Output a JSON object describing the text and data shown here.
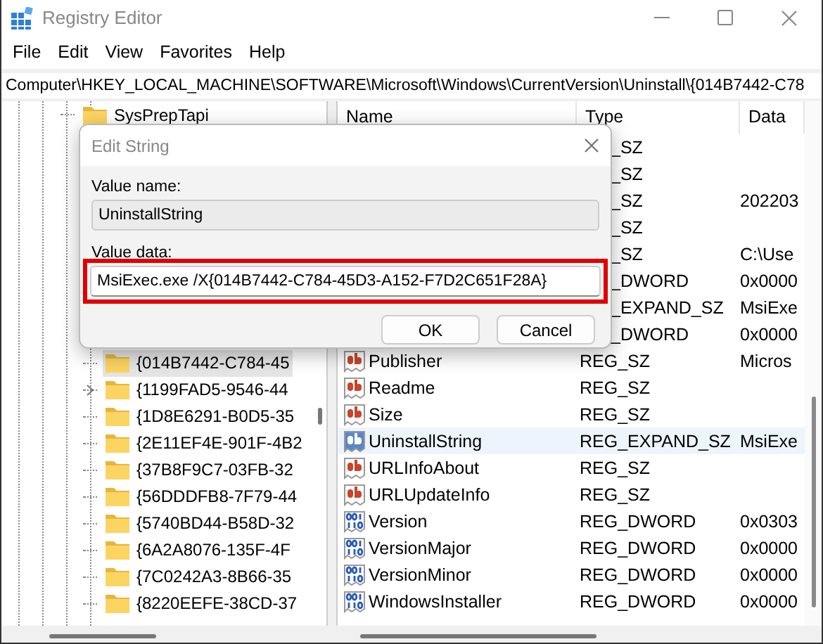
{
  "window": {
    "title": "Registry Editor"
  },
  "menu": [
    "File",
    "Edit",
    "View",
    "Favorites",
    "Help"
  ],
  "address": "Computer\\HKEY_LOCAL_MACHINE\\SOFTWARE\\Microsoft\\Windows\\CurrentVersion\\Uninstall\\{014B7442-C78",
  "tree": [
    {
      "label": "SysPrepTapi",
      "expandable": false,
      "selected": false
    },
    {
      "children": [
        {
          "label": "{014B7442-C784-45",
          "expandable": false,
          "selected": true
        },
        {
          "label": "{1199FAD5-9546-44",
          "expandable": true,
          "selected": false
        },
        {
          "label": "{1D8E6291-B0D5-35",
          "expandable": false,
          "selected": false
        },
        {
          "label": "{2E11EF4E-901F-4B2",
          "expandable": false,
          "selected": false
        },
        {
          "label": "{37B8F9C7-03FB-32",
          "expandable": false,
          "selected": false
        },
        {
          "label": "{56DDDFB8-7F79-44",
          "expandable": false,
          "selected": false
        },
        {
          "label": "{5740BD44-B58D-32",
          "expandable": false,
          "selected": false
        },
        {
          "label": "{6A2A8076-135F-4F",
          "expandable": false,
          "selected": false
        },
        {
          "label": "{7C0242A3-8B66-35",
          "expandable": false,
          "selected": false
        },
        {
          "label": "{8220EEFE-38CD-37",
          "expandable": false,
          "selected": false
        }
      ]
    }
  ],
  "columns": [
    "Name",
    "Type",
    "Data"
  ],
  "values": [
    {
      "kind": "partial",
      "type": "_SZ",
      "selected": false
    },
    {
      "kind": "partial",
      "type": "_SZ",
      "selected": false
    },
    {
      "kind": "partial",
      "type": "_SZ",
      "data": "202203",
      "selected": false
    },
    {
      "kind": "partial",
      "type": "_SZ",
      "selected": false
    },
    {
      "kind": "partial",
      "type": "_SZ",
      "data": "C:\\Use",
      "selected": false
    },
    {
      "kind": "partial",
      "type": "_DWORD",
      "data": "0x0000",
      "selected": false
    },
    {
      "kind": "partial",
      "type": "_EXPAND_SZ",
      "data": "MsiExe",
      "selected": false
    },
    {
      "kind": "partial",
      "type": "_DWORD",
      "data": "0x0000",
      "selected": false
    },
    {
      "kind": "string",
      "name": "Publisher",
      "type": "REG_SZ",
      "data": "Micros",
      "selected": false
    },
    {
      "kind": "string",
      "name": "Readme",
      "type": "REG_SZ",
      "selected": false
    },
    {
      "kind": "string",
      "name": "Size",
      "type": "REG_SZ",
      "selected": false
    },
    {
      "kind": "string",
      "name": "UninstallString",
      "type": "REG_EXPAND_SZ",
      "data": "MsiExe",
      "selected": true
    },
    {
      "kind": "string",
      "name": "URLInfoAbout",
      "type": "REG_SZ",
      "selected": false
    },
    {
      "kind": "string",
      "name": "URLUpdateInfo",
      "type": "REG_SZ",
      "selected": false
    },
    {
      "kind": "binary",
      "name": "Version",
      "type": "REG_DWORD",
      "data": "0x0303",
      "selected": false
    },
    {
      "kind": "binary",
      "name": "VersionMajor",
      "type": "REG_DWORD",
      "data": "0x0000",
      "selected": false
    },
    {
      "kind": "binary",
      "name": "VersionMinor",
      "type": "REG_DWORD",
      "data": "0x0000",
      "selected": false
    },
    {
      "kind": "binary",
      "name": "WindowsInstaller",
      "type": "REG_DWORD",
      "data": "0x0000",
      "selected": false
    }
  ],
  "dialog": {
    "title": "Edit String",
    "name_label": "Value name:",
    "name_value": "UninstallString",
    "data_label": "Value data:",
    "data_value": "MsiExec.exe /X{014B7442-C784-45D3-A152-F7D2C651F28A}",
    "data_highlighted": true,
    "buttons": [
      "OK",
      "Cancel"
    ]
  }
}
